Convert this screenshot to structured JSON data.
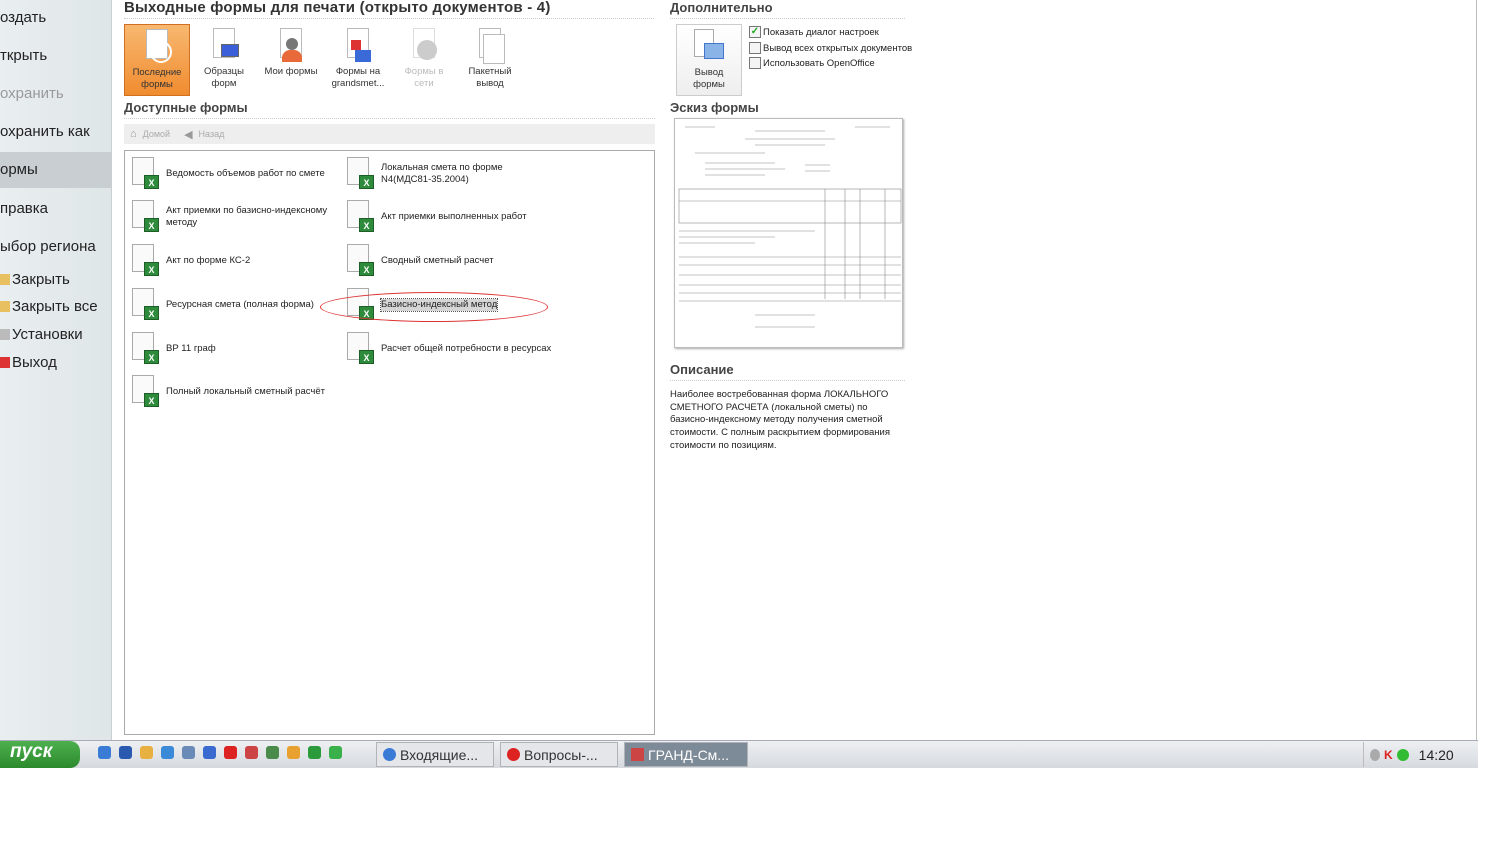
{
  "sidebar": {
    "items": [
      "оздать",
      "ткрыть",
      "охранить",
      "охранить как",
      "ормы",
      "правка",
      "ыбор региона"
    ],
    "sub": [
      "Закрыть",
      "Закрыть все",
      "Установки",
      "Выход"
    ]
  },
  "header": {
    "title": "Выходные формы для печати (открыто документов - 4)"
  },
  "toolbar": [
    {
      "l1": "Последние",
      "l2": "формы"
    },
    {
      "l1": "Образцы",
      "l2": "форм"
    },
    {
      "l1": "Мои формы",
      "l2": ""
    },
    {
      "l1": "Формы на",
      "l2": "grandsmet..."
    },
    {
      "l1": "Формы в",
      "l2": "сети"
    },
    {
      "l1": "Пакетный",
      "l2": "вывод"
    }
  ],
  "available": {
    "title": "Доступные формы",
    "home": "Домой",
    "back": "Назад"
  },
  "forms": [
    "Ведомость объемов работ по смете",
    "Локальная смета по форме N4(МДС81-35.2004)",
    "Акт приемки по базисно-индексному методу",
    "Акт приемки выполненных работ",
    "Акт по форме КС-2",
    "Сводный сметный расчет",
    "Ресурсная смета (полная форма)",
    "Базисно-индексный метод",
    "ВР 11 граф",
    "Расчет общей потребности в ресурсах",
    "Полный локальный сметный расчёт"
  ],
  "extra": {
    "title": "Дополнительно",
    "output_l1": "Вывод",
    "output_l2": "формы",
    "checks": [
      {
        "label": "Показать диалог настроек",
        "checked": true
      },
      {
        "label": "Вывод всех открытых документов",
        "checked": false
      },
      {
        "label": "Использовать OpenOffice",
        "checked": false
      }
    ]
  },
  "preview": {
    "title": "Эскиз формы"
  },
  "description": {
    "title": "Описание",
    "text": "Наиболее востребованная форма ЛОКАЛЬНОГО СМЕТНОГО РАСЧЕТА (локальной сметы) по базисно-индексному методу получения сметной стоимости. С полным раскрытием формирования стоимости по позициям."
  },
  "taskbar": {
    "start": "пуск",
    "tasks": [
      "Входящие...",
      "Вопросы-...",
      "ГРАНД-См..."
    ],
    "clock": "14:20"
  }
}
